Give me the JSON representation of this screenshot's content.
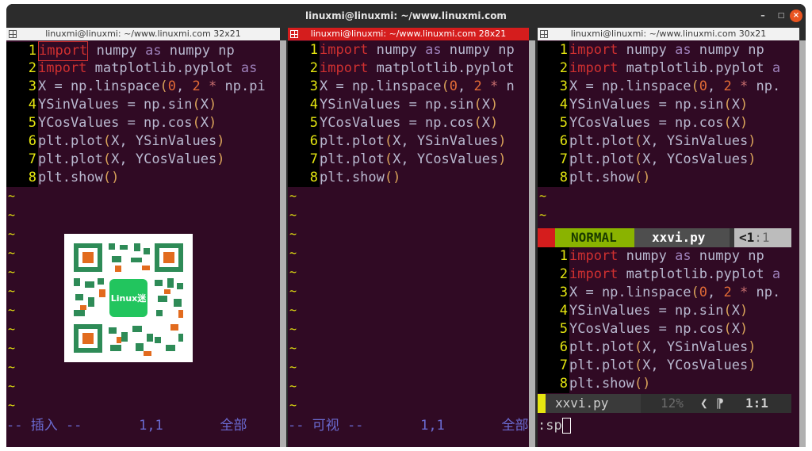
{
  "window": {
    "title": "linuxmi@linuxmi: ~/www.linuxmi.com"
  },
  "controls": {
    "minimize": "–",
    "maximize": "□",
    "close": "×"
  },
  "panes": [
    {
      "header": "linuxmi@linuxmi: ~/www.linuxmi.com 32x21",
      "mode": "-- 插入 --",
      "pos": "1,1",
      "all": "全部"
    },
    {
      "header": "linuxmi@linuxmi: ~/www.linuxmi.com 28x21",
      "mode": "-- 可视 --",
      "pos": "1,1",
      "all": "全部"
    },
    {
      "header": "linuxmi@linuxmi: ~/www.linuxmi.com 30x21"
    }
  ],
  "code": {
    "nums": [
      "1",
      "2",
      "3",
      "4",
      "5",
      "6",
      "7",
      "8"
    ],
    "import_kw": "import",
    "as_kw": "as",
    "p1": [
      " numpy ",
      "np",
      " matplotlib.pyplot ",
      "as",
      "X = np.linspace",
      "(",
      "0",
      ", ",
      "2",
      " * ",
      "np.pi",
      "YSinValues = np.sin",
      "(",
      "X",
      ")",
      "YCosValues = np.cos",
      "(",
      "X",
      ")",
      "plt.plot",
      "(",
      "X, YSinValues",
      ")",
      "plt.plot",
      "(",
      "X, YCosValues",
      ")",
      "plt.show",
      "()"
    ],
    "p2_l2": " matplotlib.pyplot",
    "p2_l3_tail": "n",
    "p3_l2_tail": "a",
    "p3_l3_tail": "np."
  },
  "tilde": "~",
  "airline": {
    "mode": "NORMAL",
    "file": "xxvi.py",
    "lt": "<",
    "line": "1",
    "col": ":1",
    "file2": "xxvi.py",
    "pct": "12%",
    "sep": "❮",
    "flag": "⁋",
    "lc": "1:1"
  },
  "cmdline": ":sp",
  "qr": {
    "label": "Linux迷"
  },
  "colors": {
    "active_header": "#d51d1d",
    "bg": "#300a24",
    "gutter_num": "#e5e510",
    "keyword": "#d03030",
    "normal_mode": "#8ab300"
  }
}
